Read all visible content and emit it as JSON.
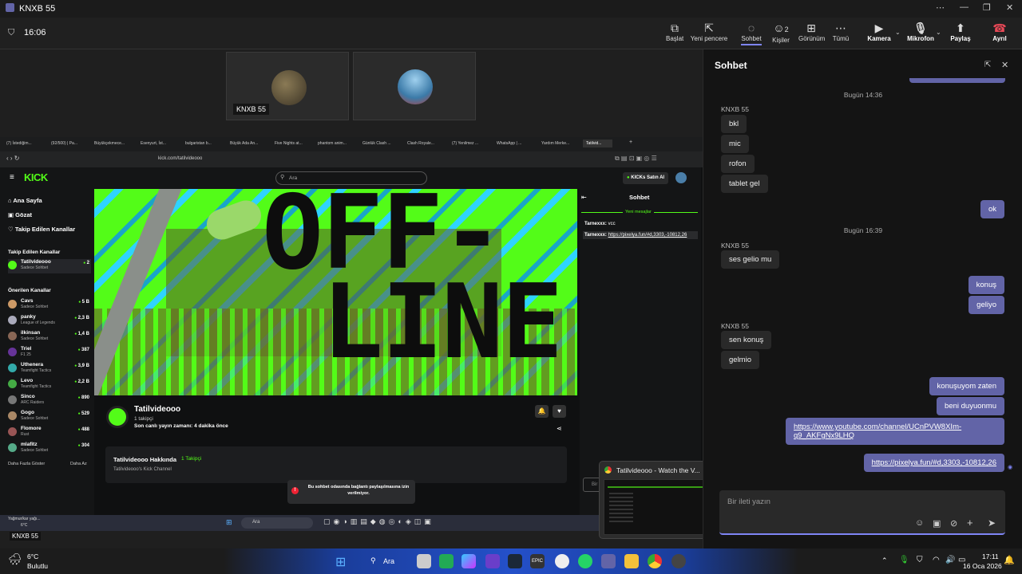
{
  "window": {
    "title": "KNXB 55",
    "controls": [
      "⋯",
      "—",
      "❐",
      "✕"
    ]
  },
  "meeting": {
    "timer": "16:06"
  },
  "toolbar": {
    "start": "Başlat",
    "new_window": "Yeni pencere",
    "chat": "Sohbet",
    "people": "Kişiler",
    "people_count": "2",
    "view": "Görünüm",
    "all": "Tümü",
    "camera": "Kamera",
    "mic": "Mikrofon",
    "share": "Paylaş",
    "leave": "Ayrıl"
  },
  "participants": [
    {
      "name": "KNXB 55"
    },
    {
      "name": ""
    }
  ],
  "browser": {
    "tabs": [
      "(7) İstediğim...",
      "(92/500) | Pa...",
      "Büyükçekmece...",
      "Esenyurt, İst...",
      "bulgaristan b...",
      "Büyük Ada An...",
      "Five Nights at...",
      "phantom anim...",
      "Günlük Clash ...",
      "Clash Royale...",
      "(7) Yenilmez ...",
      "WhatsApp | ...",
      "Yardım Merke...",
      "Tatilvid..."
    ],
    "url": "kick.com/tatilvideooo"
  },
  "kick": {
    "logo": "KICK",
    "search_placeholder": "Ara",
    "buy_kicks": "KICKs Satın Al",
    "nav": [
      "Ana Sayfa",
      "Gözat",
      "Takip Edilen Kanallar"
    ],
    "followed_header": "Takip Edilen Kanallar",
    "followed": [
      {
        "name": "Tatilvideooo",
        "sub": "Sadece Sohbet",
        "viewers": "2"
      }
    ],
    "recommended_header": "Önerilen Kanallar",
    "recommended": [
      {
        "name": "Cavs",
        "sub": "Sadece Sohbet",
        "viewers": "5 B"
      },
      {
        "name": "panky",
        "sub": "League of Legends",
        "viewers": "2,3 B"
      },
      {
        "name": "ilkinsan",
        "sub": "Sadece Sohbet",
        "viewers": "1,4 B"
      },
      {
        "name": "Triel",
        "sub": "F1 25",
        "viewers": "387"
      },
      {
        "name": "Uthenera",
        "sub": "Teamfight Tactics",
        "viewers": "3,9 B"
      },
      {
        "name": "Levo",
        "sub": "Teamfight Tactics",
        "viewers": "2,2 B"
      },
      {
        "name": "Sinco",
        "sub": "ARC Raiders",
        "viewers": "890"
      },
      {
        "name": "Gogo",
        "sub": "Sadece Sohbet",
        "viewers": "529"
      },
      {
        "name": "Flomore",
        "sub": "Rust",
        "viewers": "488"
      },
      {
        "name": "mlafitz",
        "sub": "Sadece Sohbet",
        "viewers": "304"
      }
    ],
    "show_more": "Daha Fazla Göster",
    "show_less": "Daha Az",
    "offline_top": "OFF-",
    "offline_bottom": "LINE",
    "channel_name": "Tatilvideooo",
    "followers": "1 takipçi",
    "last_live": "Son canlı yayın zamanı: 4 dakika önce",
    "about_title": "Tatilvideooo Hakkında",
    "about_followers": "1 Takipçi",
    "about_desc": "Tatilvideooo's Kick Channel",
    "chat_title": "Sohbet",
    "new_messages": "Yeni mesajlar",
    "chat_msgs": [
      {
        "user": "Tarnexxx:",
        "text": "vcc"
      },
      {
        "user": "Tarnexxx:",
        "text": "https://pixelya.fun/#d,3303,-10812,26"
      }
    ],
    "chat_input": "Bir",
    "toast": "Bu sohbet odasında bağlantı paylaşılmasına izin verilmiyor."
  },
  "inner_taskbar": {
    "weather": "Yağmur/kar yağı...",
    "temp": "6°C",
    "search": "Ara"
  },
  "stage_label": "KNXB 55",
  "preview": {
    "title": "Tatilvideooo - Watch the V..."
  },
  "chat": {
    "title": "Sohbet",
    "date1": "Bugün 14:36",
    "date2": "Bugün 16:39",
    "sender": "KNXB 55",
    "group1": [
      "bkl",
      "mic",
      "rofon",
      "tablet gel"
    ],
    "out1": "ok",
    "group2": [
      "ses gelio mu"
    ],
    "out2": [
      "konuş",
      "geliyo"
    ],
    "group3": [
      "sen konuş",
      "gelmio"
    ],
    "out3": [
      "konuşuyom zaten",
      "beni duyuonmu"
    ],
    "link1_line1": "https://www.youtube.com/channel/UCnPVW8XIm-",
    "link1_line2": "q9_AKFgNx9LHQ",
    "link2": "https://pixelya.fun/#d,3303,-10812,26",
    "composer_placeholder": "Bir ileti yazın"
  },
  "taskbar": {
    "weather_temp": "6°C",
    "weather_desc": "Bulutlu",
    "search": "Ara",
    "time": "17:11",
    "date": "16 Oca 2026"
  }
}
